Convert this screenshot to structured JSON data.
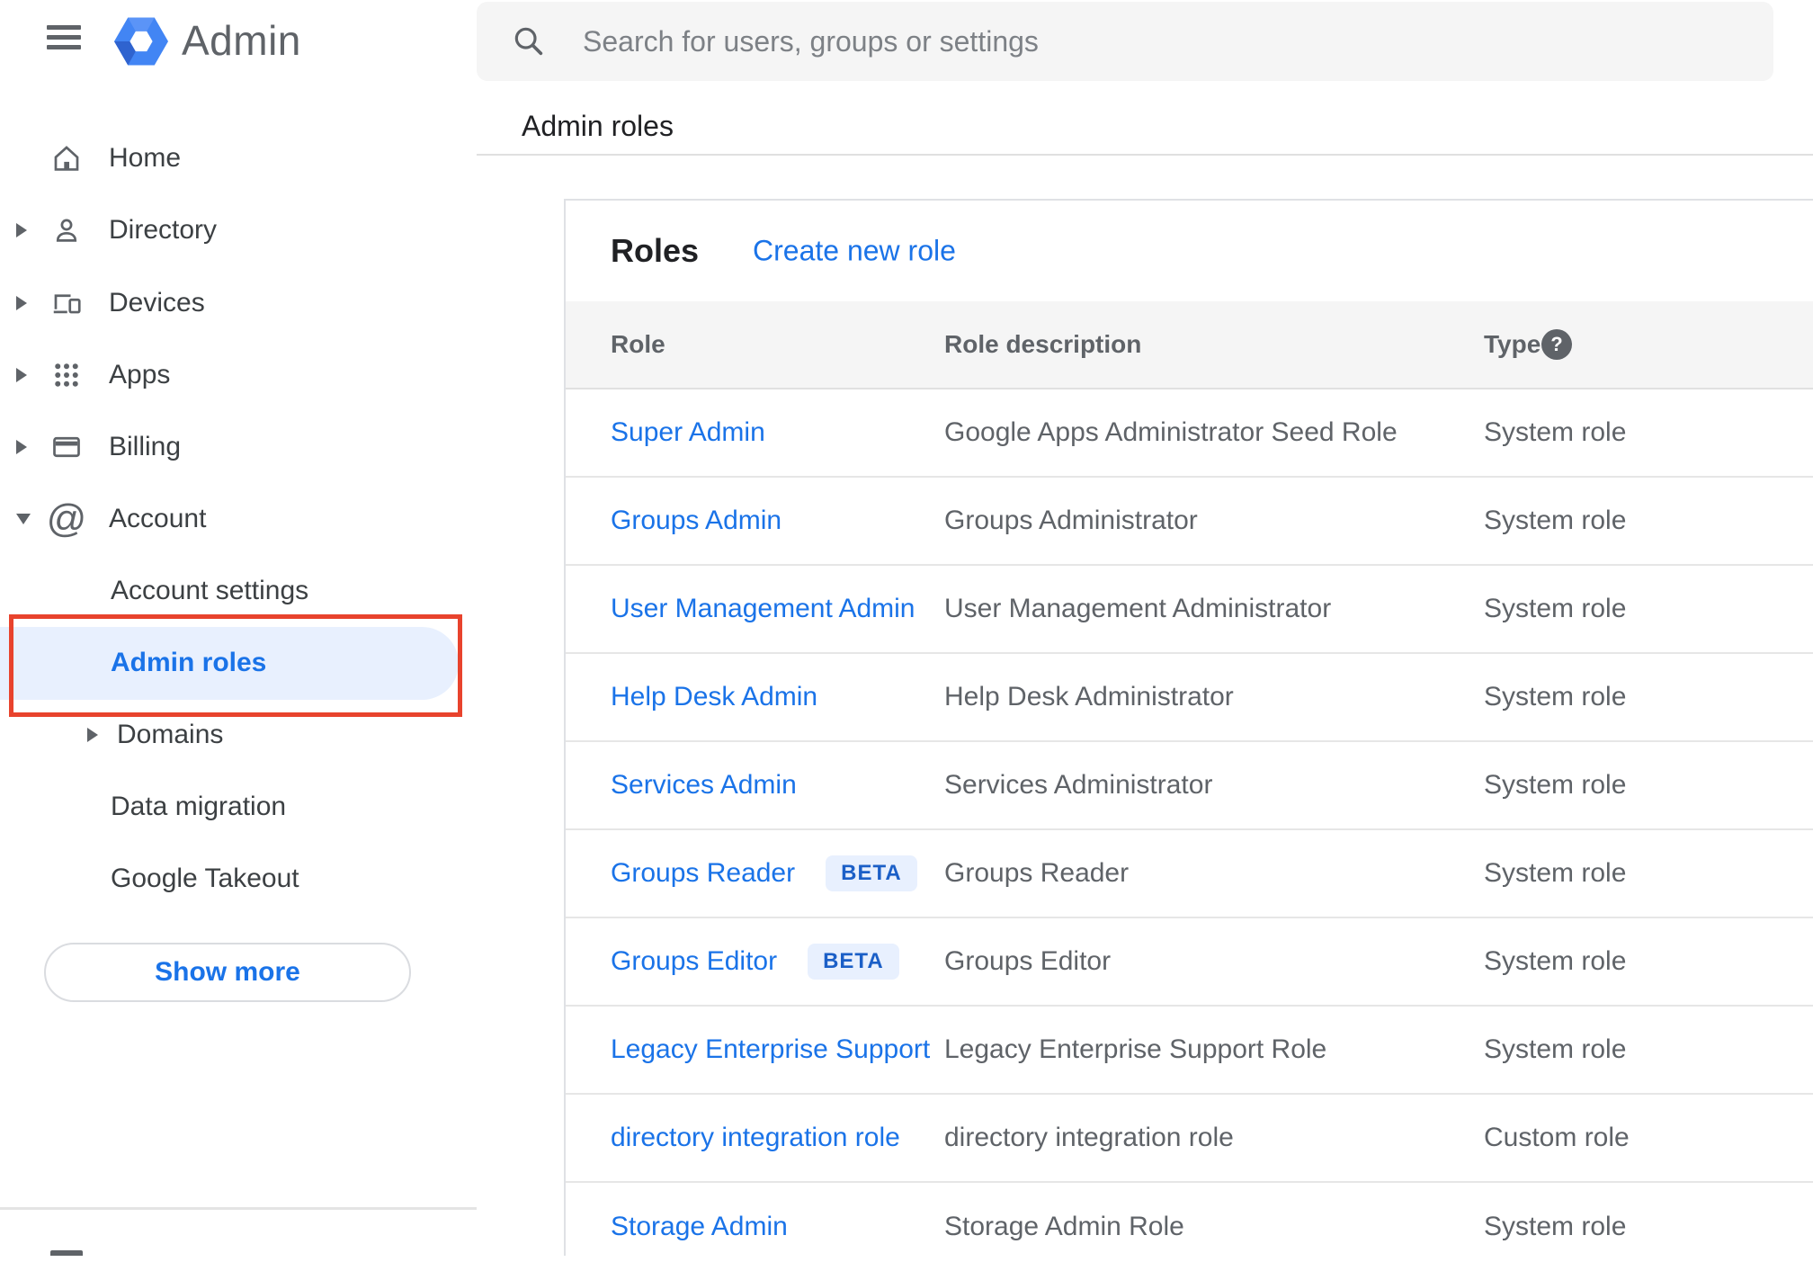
{
  "app": {
    "logo_text": "Admin"
  },
  "topbar": {
    "search_placeholder": "Search for users, groups or settings"
  },
  "breadcrumb": {
    "label": "Admin roles"
  },
  "sidebar": {
    "items": [
      {
        "label": "Home"
      },
      {
        "label": "Directory"
      },
      {
        "label": "Devices"
      },
      {
        "label": "Apps"
      },
      {
        "label": "Billing"
      },
      {
        "label": "Account"
      },
      {
        "label": "Account settings"
      },
      {
        "label": "Admin roles",
        "selected": true
      },
      {
        "label": "Domains"
      },
      {
        "label": "Data migration"
      },
      {
        "label": "Google Takeout"
      }
    ],
    "show_more_label": "Show more"
  },
  "annotation": {
    "color": "#e8432d",
    "target": "Admin roles sidebar item"
  },
  "main": {
    "card": {
      "title": "Roles",
      "create_link": "Create new role",
      "table": {
        "headers": [
          "Role",
          "Role description",
          "Type"
        ],
        "help_icon": "?",
        "rows": [
          {
            "role": "Super Admin",
            "description": "Google Apps Administrator Seed Role",
            "type": "System role"
          },
          {
            "role": "Groups Admin",
            "description": "Groups Administrator",
            "type": "System role"
          },
          {
            "role": "User Management Admin",
            "description": "User Management Administrator",
            "type": "System role"
          },
          {
            "role": "Help Desk Admin",
            "description": "Help Desk Administrator",
            "type": "System role"
          },
          {
            "role": "Services Admin",
            "description": "Services Administrator",
            "type": "System role"
          },
          {
            "role": "Groups Reader",
            "badge": "BETA",
            "description": "Groups Reader",
            "type": "System role"
          },
          {
            "role": "Groups Editor",
            "badge": "BETA",
            "description": "Groups Editor",
            "type": "System role"
          },
          {
            "role": "Legacy Enterprise Support",
            "description": "Legacy Enterprise Support Role",
            "type": "System role"
          },
          {
            "role": "directory integration role",
            "description": "directory integration role",
            "type": "Custom role"
          },
          {
            "role": "Storage Admin",
            "description": "Storage Admin Role",
            "type": "System role"
          }
        ]
      }
    }
  },
  "colors": {
    "accent_blue": "#1a73e8",
    "selected_pill": "#e8f0fe",
    "annotation_red": "#e8432d",
    "table_header_bg": "#f5f5f5",
    "icon_gray": "#5f6368"
  }
}
